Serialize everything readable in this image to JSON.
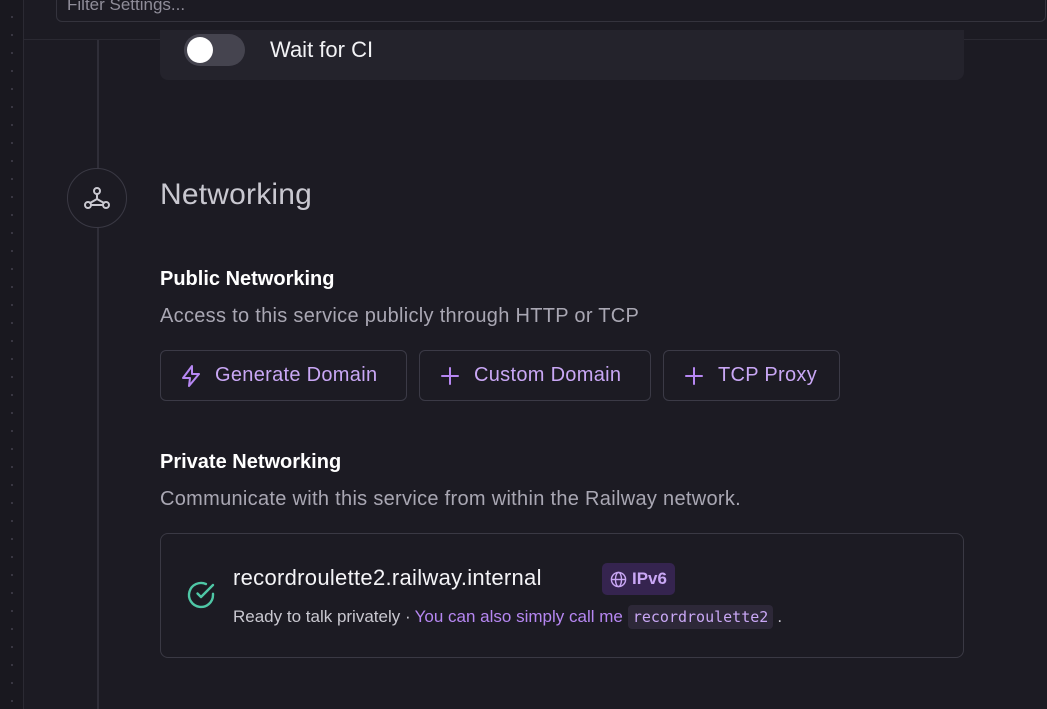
{
  "filter": {
    "placeholder": "Filter Settings..."
  },
  "ci": {
    "label": "Wait for CI",
    "enabled": false
  },
  "networking": {
    "section_title": "Networking",
    "section_icon": "network-nodes-icon",
    "public": {
      "title": "Public Networking",
      "description": "Access to this service publicly through HTTP or TCP",
      "buttons": [
        {
          "label": "Generate Domain",
          "icon": "bolt-icon"
        },
        {
          "label": "Custom Domain",
          "icon": "plus-icon"
        },
        {
          "label": "TCP Proxy",
          "icon": "plus-icon"
        }
      ]
    },
    "private": {
      "title": "Private Networking",
      "description": "Communicate with this service from within the Railway network.",
      "domain": "recordroulette2.railway.internal",
      "badge": "IPv6",
      "badge_icon": "globe-icon",
      "status": "Ready to talk privately ·",
      "hint": "You can also simply call me",
      "alias": "recordroulette2",
      "period": ".",
      "status_icon": "check-circle-icon"
    }
  },
  "colors": {
    "background": "#1c1b23",
    "accent": "#c9a7f5",
    "success": "#4fc7a6",
    "badge_bg": "#35244f"
  }
}
